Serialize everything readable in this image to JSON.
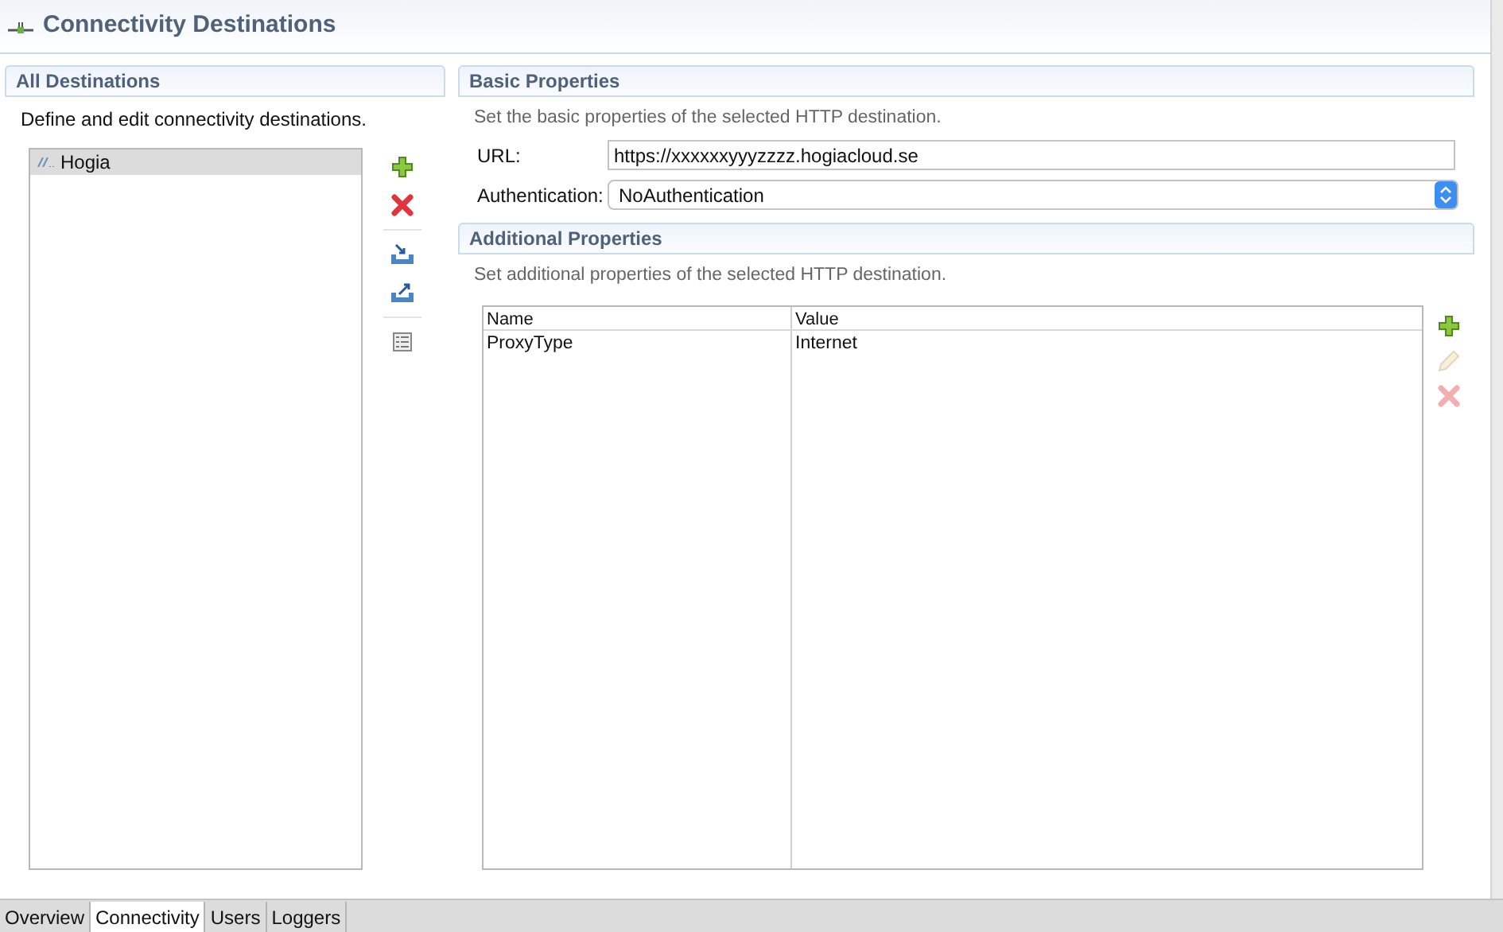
{
  "header": {
    "title": "Connectivity Destinations"
  },
  "destinations": {
    "title": "All Destinations",
    "description": "Define and edit connectivity destinations.",
    "items": [
      {
        "label": "Hogia",
        "selected": true
      }
    ],
    "tools": [
      {
        "kind": "add",
        "disabled": false
      },
      {
        "kind": "delete",
        "disabled": false
      },
      {
        "kind": "separator"
      },
      {
        "kind": "import",
        "disabled": false
      },
      {
        "kind": "export",
        "disabled": false
      },
      {
        "kind": "separator"
      },
      {
        "kind": "details",
        "disabled": false
      }
    ]
  },
  "basic": {
    "title": "Basic Properties",
    "description": "Set the basic properties of the selected HTTP destination.",
    "fields": [
      {
        "kind": "text",
        "label": "URL:",
        "value": "https://xxxxxxyyyzzzz.hogiacloud.se"
      },
      {
        "kind": "select",
        "label": "Authentication:",
        "value": "NoAuthentication"
      }
    ]
  },
  "additional": {
    "title": "Additional Properties",
    "description": "Set additional properties of the selected HTTP destination.",
    "table": {
      "columns": [
        "Name",
        "Value"
      ],
      "rows": [
        [
          "ProxyType",
          "Internet"
        ]
      ]
    },
    "tools": [
      {
        "kind": "add",
        "disabled": false
      },
      {
        "kind": "edit",
        "disabled": true
      },
      {
        "kind": "delete",
        "disabled": true
      }
    ]
  },
  "tabs": [
    {
      "label": "Overview",
      "selected": false
    },
    {
      "label": "Connectivity",
      "selected": true
    },
    {
      "label": "Users",
      "selected": false
    },
    {
      "label": "Loggers",
      "selected": false
    }
  ]
}
